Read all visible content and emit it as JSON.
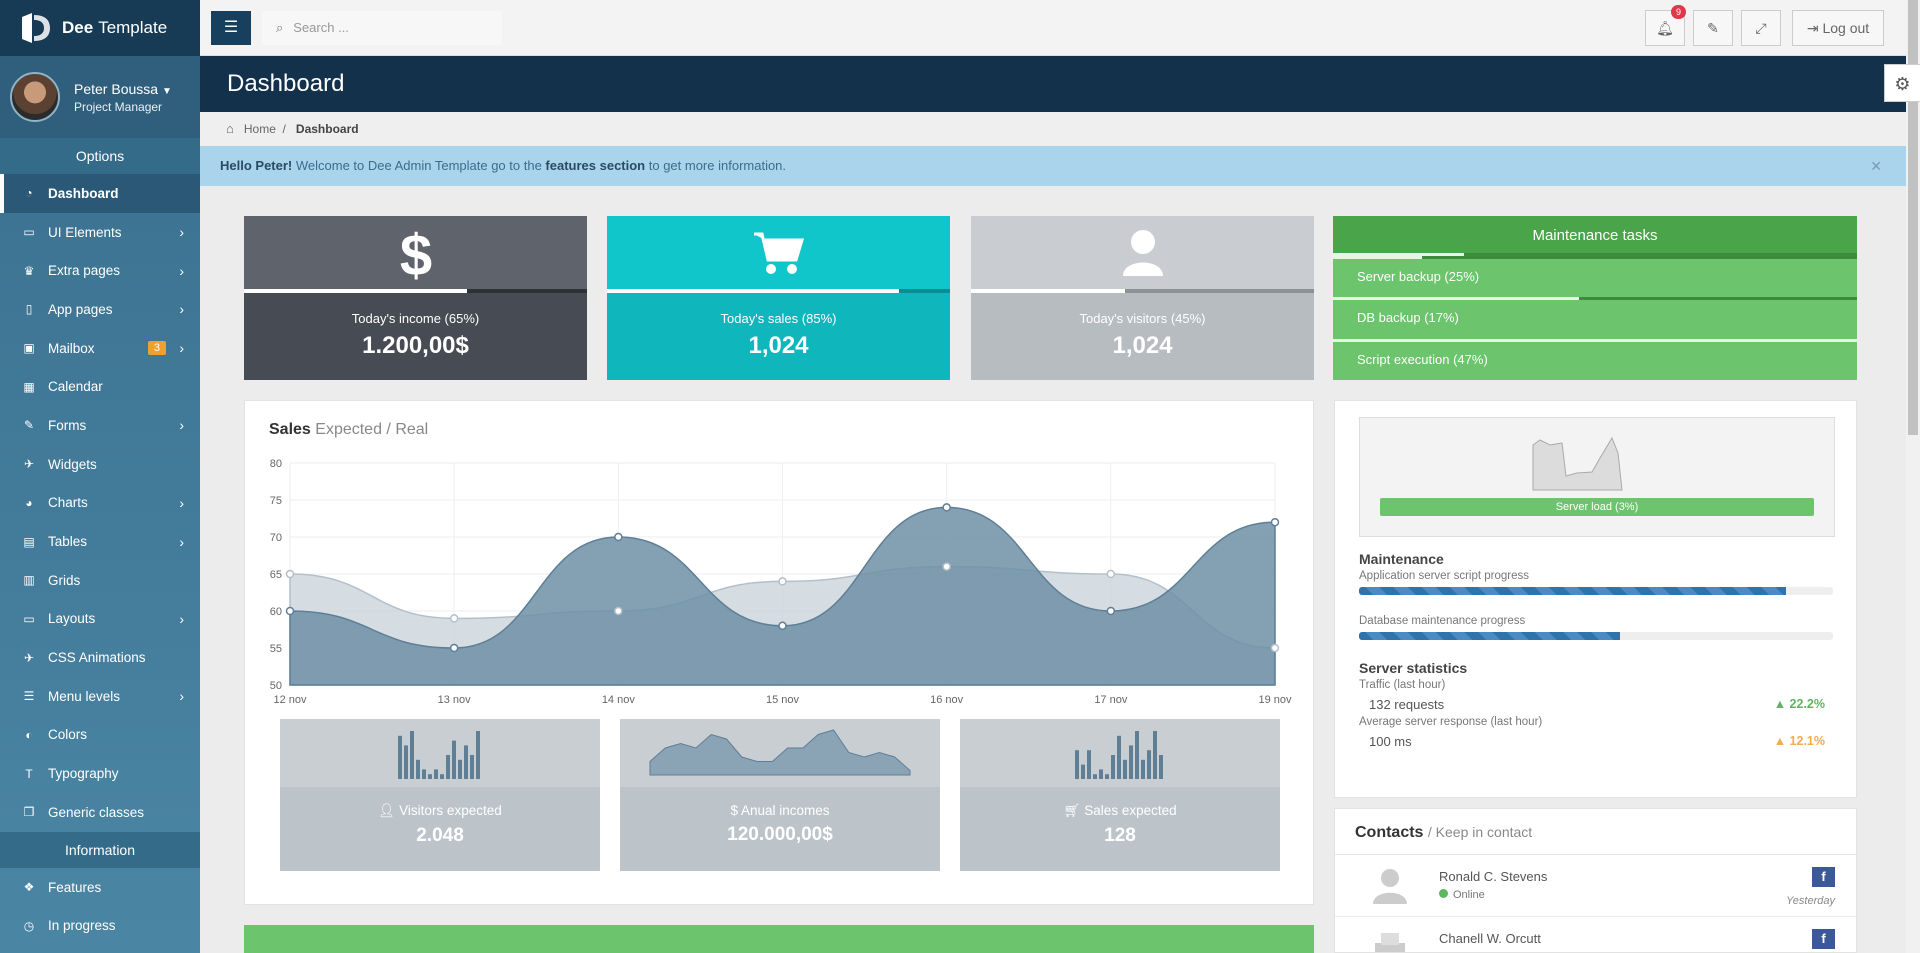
{
  "app": {
    "brand_bold": "Dee",
    "brand_rest": "Template"
  },
  "user": {
    "name": "Peter Boussa",
    "role": "Project Manager"
  },
  "sidebar": {
    "options_title": "Options",
    "items": [
      {
        "label": "Dashboard",
        "icon": "dashboard-icon"
      },
      {
        "label": "UI Elements",
        "icon": "monitor-icon"
      },
      {
        "label": "Extra pages",
        "icon": "trophy-icon"
      },
      {
        "label": "App pages",
        "icon": "file-icon"
      },
      {
        "label": "Mailbox",
        "icon": "inbox-icon",
        "badge": "3"
      },
      {
        "label": "Calendar",
        "icon": "calendar-icon"
      },
      {
        "label": "Forms",
        "icon": "edit-icon"
      },
      {
        "label": "Widgets",
        "icon": "widget-icon"
      },
      {
        "label": "Charts",
        "icon": "pie-chart-icon"
      },
      {
        "label": "Tables",
        "icon": "table-icon"
      },
      {
        "label": "Grids",
        "icon": "grid-icon"
      },
      {
        "label": "Layouts",
        "icon": "laptop-icon"
      },
      {
        "label": "CSS Animations",
        "icon": "plane-icon"
      },
      {
        "label": "Menu levels",
        "icon": "list-icon"
      },
      {
        "label": "Colors",
        "icon": "contrast-icon"
      },
      {
        "label": "Typography",
        "icon": "text-icon"
      },
      {
        "label": "Generic classes",
        "icon": "cubes-icon"
      }
    ],
    "info_title": "Information",
    "info_items": [
      {
        "label": "Features",
        "icon": "dropbox-icon"
      },
      {
        "label": "In progress",
        "icon": "clock-icon"
      }
    ]
  },
  "topbar": {
    "search_placeholder": "Search ...",
    "notif_count": "9",
    "logout_label": "Log out"
  },
  "header": {
    "title": "Dashboard"
  },
  "breadcrumb": {
    "home": "Home",
    "current": "Dashboard"
  },
  "alert": {
    "strong": "Hello Peter!",
    "text": " Welcome to Dee Admin Template go to the ",
    "link": "features section",
    "tail": " to get more information."
  },
  "stats": [
    {
      "label": "Today's income (65%)",
      "value": "1.200,00$",
      "progress": 0.65,
      "color": "#5f636b"
    },
    {
      "label": "Today's sales (85%)",
      "value": "1,024",
      "progress": 0.85,
      "color": "#10c6cb"
    },
    {
      "label": "Today's visitors (45%)",
      "value": "1,024",
      "progress": 0.45,
      "color": "#c6cace"
    }
  ],
  "maintenance": {
    "title": "Maintenance tasks",
    "title_progress": 0.25,
    "rows": [
      {
        "label": "Server backup (25%)",
        "progress": 0.17
      },
      {
        "label": "DB backup (17%)",
        "progress": 0.47
      },
      {
        "label": "Script execution (47%)",
        "progress": 1.0
      }
    ]
  },
  "sales": {
    "title": "Sales",
    "subtitle": "Expected / Real"
  },
  "chart_data": {
    "type": "area",
    "categories": [
      "12 nov",
      "13 nov",
      "14 nov",
      "15 nov",
      "16 nov",
      "17 nov",
      "19 nov"
    ],
    "ylim": [
      50,
      80
    ],
    "yticks": [
      "80",
      "75",
      "70",
      "65",
      "60",
      "55",
      "50"
    ],
    "series": [
      {
        "values": [
          65,
          59,
          60,
          64,
          66,
          65,
          55
        ],
        "color": "#c7d1d9"
      },
      {
        "values": [
          60,
          55,
          70,
          58,
          74,
          60,
          72
        ],
        "color": "#6f8fa6"
      }
    ]
  },
  "minis": [
    {
      "label": "Visitors expected",
      "value": "2.048",
      "icon": "user-icon",
      "bars": [
        9,
        7,
        10,
        4,
        2,
        1,
        2,
        1,
        5,
        8,
        4,
        7,
        5,
        10
      ]
    },
    {
      "label": "Anual incomes",
      "value": "120.000,00$",
      "icon": "dollar-icon",
      "line": [
        3,
        6,
        7,
        6,
        9,
        8,
        4,
        3,
        3,
        6,
        6,
        9,
        10,
        5,
        4,
        5,
        4,
        1
      ]
    },
    {
      "label": "Sales expected",
      "value": "128",
      "icon": "cart-icon",
      "bars": [
        6,
        3,
        6,
        1,
        2,
        1,
        5,
        9,
        4,
        7,
        10,
        4,
        6,
        10,
        5
      ]
    }
  ],
  "server": {
    "load_label": "Server load (3%)",
    "maintenance_title": "Maintenance",
    "app_progress_label": "Application server script progress",
    "app_progress": 0.9,
    "db_progress_label": "Database maintenance progress",
    "db_progress": 0.55,
    "stats_title": "Server statistics",
    "traffic_label": "Traffic (last hour)",
    "traffic_value": "132 requests",
    "traffic_trend": "22.2%",
    "response_label": "Average server response (last hour)",
    "response_value": "100 ms",
    "response_trend": "12.1%"
  },
  "contacts": {
    "title": "Contacts",
    "subtitle": "/ Keep in contact",
    "list": [
      {
        "name": "Ronald C. Stevens",
        "status": "Online",
        "when": "Yesterday"
      },
      {
        "name": "Chanell W. Orcutt",
        "status": "",
        "when": ""
      }
    ]
  }
}
